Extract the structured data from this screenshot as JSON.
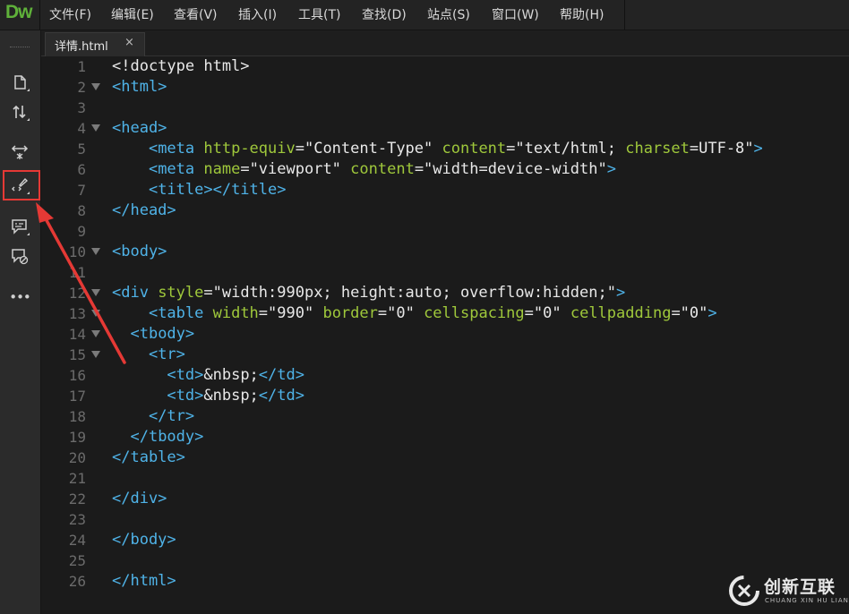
{
  "app": {
    "logo": "Dw"
  },
  "menu": [
    {
      "label": "文件(F)"
    },
    {
      "label": "编辑(E)"
    },
    {
      "label": "查看(V)"
    },
    {
      "label": "插入(I)"
    },
    {
      "label": "工具(T)"
    },
    {
      "label": "查找(D)"
    },
    {
      "label": "站点(S)"
    },
    {
      "label": "窗口(W)"
    },
    {
      "label": "帮助(H)"
    }
  ],
  "tab": {
    "label": "详情.html",
    "close": "×"
  },
  "toolbar": {
    "icons": [
      "new-file-icon",
      "sort-icon",
      "expand-icon",
      "format-code-icon",
      "comment-icon",
      "remove-comment-icon",
      "more-icon"
    ],
    "more_label": "•••"
  },
  "colors": {
    "tag": "#4fb3e8",
    "attr": "#9fc83b",
    "text": "#e8e8e8",
    "highlight": "#e53935"
  },
  "code": [
    {
      "n": "1",
      "fold": false,
      "tokens": [
        [
          "p",
          "<!doctype html>"
        ]
      ]
    },
    {
      "n": "2",
      "fold": true,
      "tokens": [
        [
          "t",
          "<html>"
        ]
      ]
    },
    {
      "n": "3",
      "fold": false,
      "tokens": []
    },
    {
      "n": "4",
      "fold": true,
      "tokens": [
        [
          "t",
          "<head>"
        ]
      ]
    },
    {
      "n": "5",
      "fold": false,
      "tokens": [
        [
          "p",
          "    "
        ],
        [
          "t",
          "<meta "
        ],
        [
          "a",
          "http-equiv"
        ],
        [
          "s",
          "=\"Content-Type\" "
        ],
        [
          "a",
          "content"
        ],
        [
          "s",
          "=\"text/html; "
        ],
        [
          "a",
          "charset"
        ],
        [
          "s",
          "=UTF-8\""
        ],
        [
          "t",
          ">"
        ]
      ]
    },
    {
      "n": "6",
      "fold": false,
      "tokens": [
        [
          "p",
          "    "
        ],
        [
          "t",
          "<meta "
        ],
        [
          "a",
          "name"
        ],
        [
          "s",
          "=\"viewport\" "
        ],
        [
          "a",
          "content"
        ],
        [
          "s",
          "=\"width=device-width\""
        ],
        [
          "t",
          ">"
        ]
      ]
    },
    {
      "n": "7",
      "fold": false,
      "tokens": [
        [
          "p",
          "    "
        ],
        [
          "t",
          "<title></title>"
        ]
      ]
    },
    {
      "n": "8",
      "fold": false,
      "tokens": [
        [
          "t",
          "</head>"
        ]
      ]
    },
    {
      "n": "9",
      "fold": false,
      "tokens": []
    },
    {
      "n": "10",
      "fold": true,
      "tokens": [
        [
          "t",
          "<body>"
        ]
      ]
    },
    {
      "n": "11",
      "fold": false,
      "tokens": []
    },
    {
      "n": "12",
      "fold": true,
      "tokens": [
        [
          "t",
          "<div "
        ],
        [
          "a",
          "style"
        ],
        [
          "s",
          "=\"width:990px; height:auto; overflow:hidden;\""
        ],
        [
          "t",
          ">"
        ]
      ]
    },
    {
      "n": "13",
      "fold": true,
      "tokens": [
        [
          "p",
          "    "
        ],
        [
          "t",
          "<table "
        ],
        [
          "a",
          "width"
        ],
        [
          "s",
          "=\"990\" "
        ],
        [
          "a",
          "border"
        ],
        [
          "s",
          "=\"0\" "
        ],
        [
          "a",
          "cellspacing"
        ],
        [
          "s",
          "=\"0\" "
        ],
        [
          "a",
          "cellpadding"
        ],
        [
          "s",
          "=\"0\""
        ],
        [
          "t",
          ">"
        ]
      ]
    },
    {
      "n": "14",
      "fold": true,
      "tokens": [
        [
          "p",
          "  "
        ],
        [
          "t",
          "<tbody>"
        ]
      ]
    },
    {
      "n": "15",
      "fold": true,
      "tokens": [
        [
          "p",
          "    "
        ],
        [
          "t",
          "<tr>"
        ]
      ]
    },
    {
      "n": "16",
      "fold": false,
      "tokens": [
        [
          "p",
          "      "
        ],
        [
          "t",
          "<td>"
        ],
        [
          "p",
          "&nbsp;"
        ],
        [
          "t",
          "</td>"
        ]
      ]
    },
    {
      "n": "17",
      "fold": false,
      "tokens": [
        [
          "p",
          "      "
        ],
        [
          "t",
          "<td>"
        ],
        [
          "p",
          "&nbsp;"
        ],
        [
          "t",
          "</td>"
        ]
      ]
    },
    {
      "n": "18",
      "fold": false,
      "tokens": [
        [
          "p",
          "    "
        ],
        [
          "t",
          "</tr>"
        ]
      ]
    },
    {
      "n": "19",
      "fold": false,
      "tokens": [
        [
          "p",
          "  "
        ],
        [
          "t",
          "</tbody>"
        ]
      ]
    },
    {
      "n": "20",
      "fold": false,
      "tokens": [
        [
          "t",
          "</table>"
        ]
      ]
    },
    {
      "n": "21",
      "fold": false,
      "tokens": []
    },
    {
      "n": "22",
      "fold": false,
      "tokens": [
        [
          "t",
          "</div>"
        ]
      ]
    },
    {
      "n": "23",
      "fold": false,
      "tokens": []
    },
    {
      "n": "24",
      "fold": false,
      "tokens": [
        [
          "t",
          "</body>"
        ]
      ]
    },
    {
      "n": "25",
      "fold": false,
      "tokens": []
    },
    {
      "n": "26",
      "fold": false,
      "tokens": [
        [
          "t",
          "</html>"
        ]
      ]
    }
  ],
  "watermark": {
    "title": "创新互联",
    "subtitle": "CHUANG XIN HU LIAN"
  }
}
